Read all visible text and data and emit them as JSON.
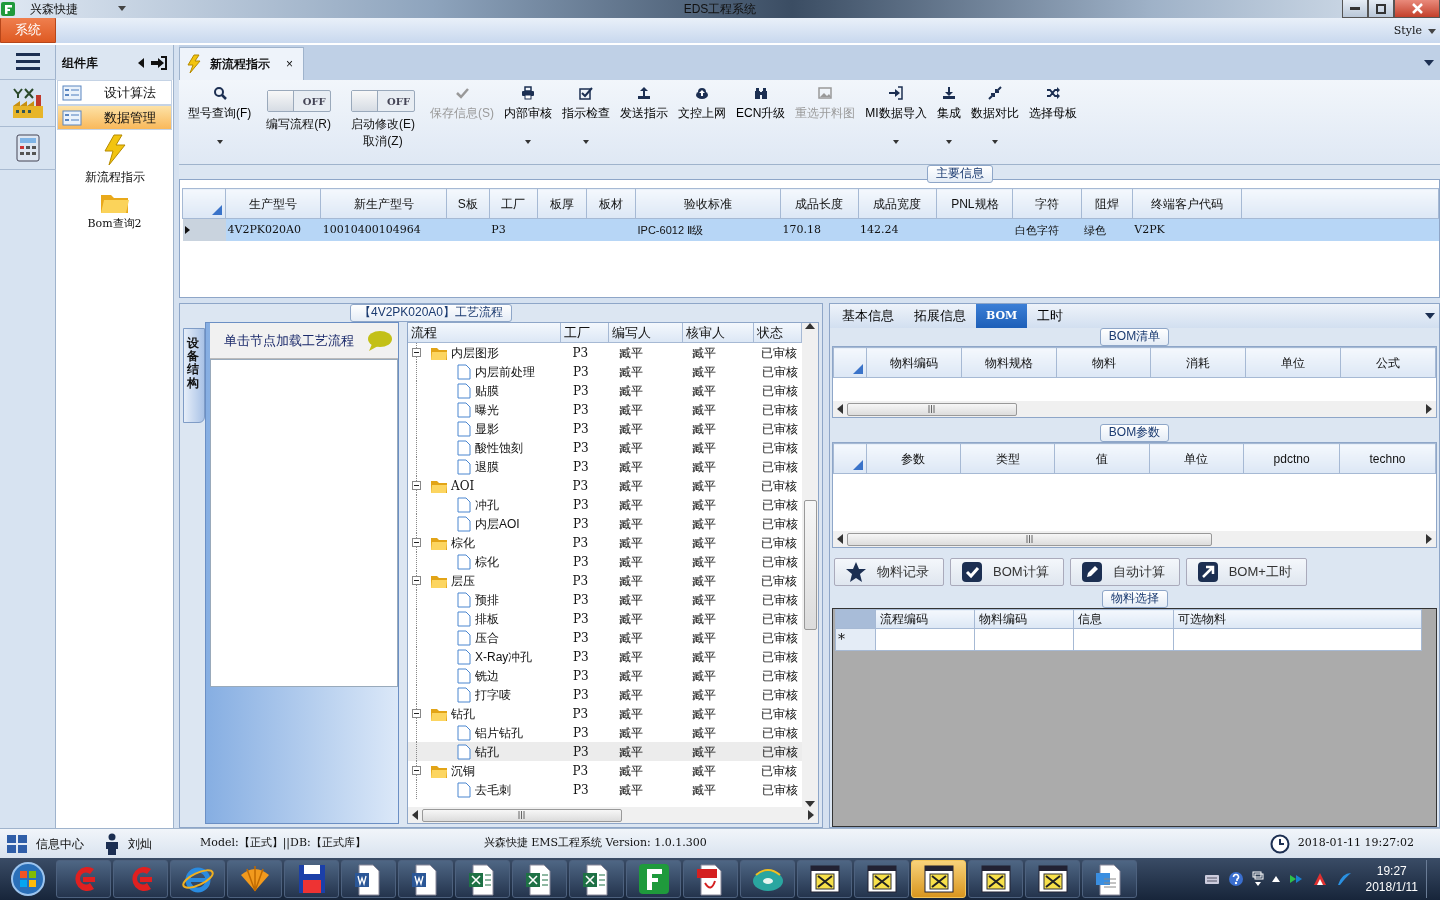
{
  "window": {
    "app_name": "兴森快捷",
    "title": "EDS工程系统"
  },
  "ribbon": {
    "tabs": [
      {
        "label": "系统",
        "selected": true
      }
    ],
    "style_label": "Style"
  },
  "component_panel": {
    "title": "组件库",
    "items": [
      {
        "label": "设计算法",
        "selected": false
      },
      {
        "label": "数据管理",
        "selected": true
      }
    ],
    "tools": [
      {
        "label": "新流程指示"
      },
      {
        "label": "Bom查询2"
      }
    ]
  },
  "doc_tabs": [
    {
      "label": "新流程指示",
      "selected": true,
      "close": "×"
    }
  ],
  "toolbar": [
    {
      "kind": "button",
      "label": "型号查询(F)",
      "disabled": false,
      "dropdown": true
    },
    {
      "kind": "toggle",
      "lines": [
        "编写流程(R)"
      ],
      "on": false,
      "state_text": "OFF"
    },
    {
      "kind": "toggle",
      "lines": [
        "启动修改(E)",
        "取消(Z)"
      ],
      "on": false,
      "state_text": "OFF"
    },
    {
      "kind": "button",
      "label": "保存信息(S)",
      "disabled": true,
      "dropdown": false
    },
    {
      "kind": "button",
      "label": "内部审核",
      "disabled": false,
      "dropdown": true
    },
    {
      "kind": "button",
      "label": "指示检查",
      "disabled": false,
      "dropdown": true
    },
    {
      "kind": "button",
      "label": "发送指示",
      "disabled": false,
      "dropdown": false
    },
    {
      "kind": "button",
      "label": "文控上网",
      "disabled": false,
      "dropdown": false
    },
    {
      "kind": "button",
      "label": "ECN升级",
      "disabled": false,
      "dropdown": false
    },
    {
      "kind": "button",
      "label": "重选开料图",
      "disabled": true,
      "dropdown": false
    },
    {
      "kind": "button",
      "label": "MI数据导入",
      "disabled": false,
      "dropdown": true
    },
    {
      "kind": "button",
      "label": "集成",
      "disabled": false,
      "dropdown": true
    },
    {
      "kind": "button",
      "label": "数据对比",
      "disabled": false,
      "dropdown": true
    },
    {
      "kind": "button",
      "label": "选择母板",
      "disabled": false,
      "dropdown": false
    }
  ],
  "main_info": {
    "title": "主要信息",
    "columns": [
      "生产型号",
      "新生产型号",
      "S板",
      "工厂",
      "板厚",
      "板材",
      "验收标准",
      "成品长度",
      "成品宽度",
      "PNL规格",
      "字符",
      "阻焊",
      "终端客户代码"
    ],
    "rows": [
      {
        "selected": true,
        "cells": [
          "4V2PK020A0",
          "10010400104964",
          null,
          "P3",
          null,
          null,
          "IPC-6012 Ⅱ级",
          "170.18",
          "142.24",
          null,
          "白色字符",
          "绿色",
          "V2PK"
        ]
      }
    ]
  },
  "process": {
    "title": "【4V2PK020A0】工艺流程",
    "side_tab": "设备结构",
    "hint": "单击节点加载工艺流程",
    "columns": [
      "流程",
      "工厂",
      "编写人",
      "核审人",
      "状态"
    ],
    "tree": [
      {
        "label": "内层图形",
        "factory": "P3",
        "writer": "臧平",
        "reviewer": "臧平",
        "status": "已审核",
        "expanded": true,
        "selected": false,
        "children": [
          {
            "label": "内层前处理",
            "factory": "P3",
            "writer": "臧平",
            "reviewer": "臧平",
            "status": "已审核",
            "selected": false
          },
          {
            "label": "贴膜",
            "factory": "P3",
            "writer": "臧平",
            "reviewer": "臧平",
            "status": "已审核",
            "selected": false
          },
          {
            "label": "曝光",
            "factory": "P3",
            "writer": "臧平",
            "reviewer": "臧平",
            "status": "已审核",
            "selected": false
          },
          {
            "label": "显影",
            "factory": "P3",
            "writer": "臧平",
            "reviewer": "臧平",
            "status": "已审核",
            "selected": false
          },
          {
            "label": "酸性蚀刻",
            "factory": "P3",
            "writer": "臧平",
            "reviewer": "臧平",
            "status": "已审核",
            "selected": false
          },
          {
            "label": "退膜",
            "factory": "P3",
            "writer": "臧平",
            "reviewer": "臧平",
            "status": "已审核",
            "selected": false
          }
        ]
      },
      {
        "label": "AOI",
        "factory": "P3",
        "writer": "臧平",
        "reviewer": "臧平",
        "status": "已审核",
        "expanded": true,
        "selected": false,
        "children": [
          {
            "label": "冲孔",
            "factory": "P3",
            "writer": "臧平",
            "reviewer": "臧平",
            "status": "已审核",
            "selected": false
          },
          {
            "label": "内层AOI",
            "factory": "P3",
            "writer": "臧平",
            "reviewer": "臧平",
            "status": "已审核",
            "selected": false
          }
        ]
      },
      {
        "label": "棕化",
        "factory": "P3",
        "writer": "臧平",
        "reviewer": "臧平",
        "status": "已审核",
        "expanded": true,
        "selected": false,
        "children": [
          {
            "label": "棕化",
            "factory": "P3",
            "writer": "臧平",
            "reviewer": "臧平",
            "status": "已审核",
            "selected": false
          }
        ]
      },
      {
        "label": "层压",
        "factory": "P3",
        "writer": "臧平",
        "reviewer": "臧平",
        "status": "已审核",
        "expanded": true,
        "selected": false,
        "children": [
          {
            "label": "预排",
            "factory": "P3",
            "writer": "臧平",
            "reviewer": "臧平",
            "status": "已审核",
            "selected": false
          },
          {
            "label": "排板",
            "factory": "P3",
            "writer": "臧平",
            "reviewer": "臧平",
            "status": "已审核",
            "selected": false
          },
          {
            "label": "压合",
            "factory": "P3",
            "writer": "臧平",
            "reviewer": "臧平",
            "status": "已审核",
            "selected": false
          },
          {
            "label": "X-Ray冲孔",
            "factory": "P3",
            "writer": "臧平",
            "reviewer": "臧平",
            "status": "已审核",
            "selected": false
          },
          {
            "label": "铣边",
            "factory": "P3",
            "writer": "臧平",
            "reviewer": "臧平",
            "status": "已审核",
            "selected": false
          },
          {
            "label": "打字唛",
            "factory": "P3",
            "writer": "臧平",
            "reviewer": "臧平",
            "status": "已审核",
            "selected": false
          }
        ]
      },
      {
        "label": "钻孔",
        "factory": "P3",
        "writer": "臧平",
        "reviewer": "臧平",
        "status": "已审核",
        "expanded": true,
        "selected": false,
        "children": [
          {
            "label": "铝片钻孔",
            "factory": "P3",
            "writer": "臧平",
            "reviewer": "臧平",
            "status": "已审核",
            "selected": false
          },
          {
            "label": "钻孔",
            "factory": "P3",
            "writer": "臧平",
            "reviewer": "臧平",
            "status": "已审核",
            "selected": true
          }
        ]
      },
      {
        "label": "沉铜",
        "factory": "P3",
        "writer": "臧平",
        "reviewer": "臧平",
        "status": "已审核",
        "expanded": true,
        "selected": false,
        "children": [
          {
            "label": "去毛刺",
            "factory": "P3",
            "writer": "臧平",
            "reviewer": "臧平",
            "status": "已审核",
            "selected": false
          }
        ]
      }
    ]
  },
  "details": {
    "tabs": [
      {
        "label": "基本信息",
        "selected": false
      },
      {
        "label": "拓展信息",
        "selected": false
      },
      {
        "label": "BOM",
        "selected": true
      },
      {
        "label": "工时",
        "selected": false
      }
    ],
    "bom_list": {
      "title": "BOM清单",
      "columns": [
        "物料编码",
        "物料规格",
        "物料",
        "消耗",
        "单位",
        "公式"
      ]
    },
    "bom_params": {
      "title": "BOM参数",
      "columns": [
        "参数",
        "类型",
        "值",
        "单位",
        "pdctno",
        "techno"
      ]
    },
    "actions": [
      {
        "label": "物料记录"
      },
      {
        "label": "BOM计算"
      },
      {
        "label": "自动计算"
      },
      {
        "label": "BOM+工时"
      }
    ],
    "material_select": {
      "title": "物料选择",
      "columns": [
        "流程编码",
        "物料编码",
        "信息",
        "可选物料"
      ],
      "new_row_marker": "*"
    }
  },
  "status_bar": {
    "info_center": "信息中心",
    "user": "刘灿",
    "model": "Model:【正式】||DB:【正式库】",
    "product": "兴森快捷 EMS工程系统 Version: 1.0.1.300",
    "datetime": "2018-01-11 19:27:02"
  },
  "taskbar": {
    "buttons": [
      {
        "kind": "start",
        "selected": false
      },
      {
        "kind": "g",
        "selected": false
      },
      {
        "kind": "g",
        "selected": false
      },
      {
        "kind": "ie",
        "selected": false
      },
      {
        "kind": "shell",
        "selected": false
      },
      {
        "kind": "save",
        "selected": false
      },
      {
        "kind": "word",
        "selected": false
      },
      {
        "kind": "word",
        "selected": false
      },
      {
        "kind": "excel",
        "selected": false
      },
      {
        "kind": "excel",
        "selected": false
      },
      {
        "kind": "excel",
        "selected": false
      },
      {
        "kind": "f",
        "selected": false
      },
      {
        "kind": "pdf",
        "selected": false
      },
      {
        "kind": "disc",
        "selected": false
      },
      {
        "kind": "x",
        "selected": false
      },
      {
        "kind": "x",
        "selected": false
      },
      {
        "kind": "x",
        "selected": true
      },
      {
        "kind": "x",
        "selected": false
      },
      {
        "kind": "x",
        "selected": false
      },
      {
        "kind": "doc",
        "selected": false
      }
    ],
    "time": "19:27",
    "date": "2018/1/11"
  }
}
